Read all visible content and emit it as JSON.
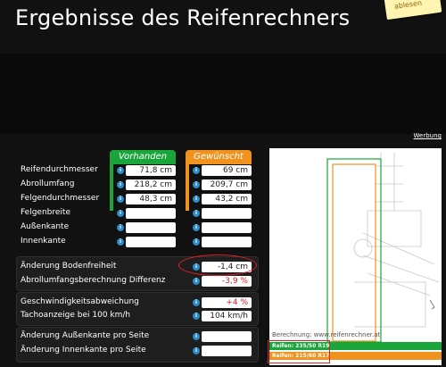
{
  "page": {
    "title": "Ergebnisse des Reifenrechners",
    "note": "ablesen",
    "ad_link": "Werbung"
  },
  "columns": {
    "vorhanden": "Vorhanden",
    "gewuenscht": "Gewünscht"
  },
  "rows": [
    {
      "label": "Reifendurchmesser",
      "vorhanden": "71,8 cm",
      "gewuenscht": "69 cm"
    },
    {
      "label": "Abrollumfang",
      "vorhanden": "218,2 cm",
      "gewuenscht": "209,7 cm"
    },
    {
      "label": "Felgendurchmesser",
      "vorhanden": "48,3 cm",
      "gewuenscht": "43,2 cm"
    },
    {
      "label": "Felgenbreite",
      "vorhanden": "",
      "gewuenscht": ""
    },
    {
      "label": "Außenkante",
      "vorhanden": "",
      "gewuenscht": ""
    },
    {
      "label": "Innenkante",
      "vorhanden": "",
      "gewuenscht": ""
    }
  ],
  "diff": {
    "bodenfreiheit_label": "Änderung Bodenfreiheit",
    "bodenfreiheit_value": "-1,4 cm",
    "abrollumfang_label": "Abrollumfangsberechnung Differenz",
    "abrollumfang_value": "-3,9 %"
  },
  "speed": {
    "abweichung_label": "Geschwindigkeitsabweichung",
    "abweichung_value": "+4 %",
    "tacho_label": "Tachoanzeige bei 100 km/h",
    "tacho_value": "104 km/h"
  },
  "edges": {
    "aussen_label": "Änderung Außenkante pro Seite",
    "aussen_value": "",
    "innen_label": "Änderung Innenkante pro Seite",
    "innen_value": ""
  },
  "diagram": {
    "caption": "Berechnung: www.reifenrechner.at",
    "legend_green": "Reifen: 235/50 R19",
    "legend_orange": "Reifen: 215/60 R17",
    "color_green": "#1aa53a",
    "color_orange": "#f0921e"
  }
}
